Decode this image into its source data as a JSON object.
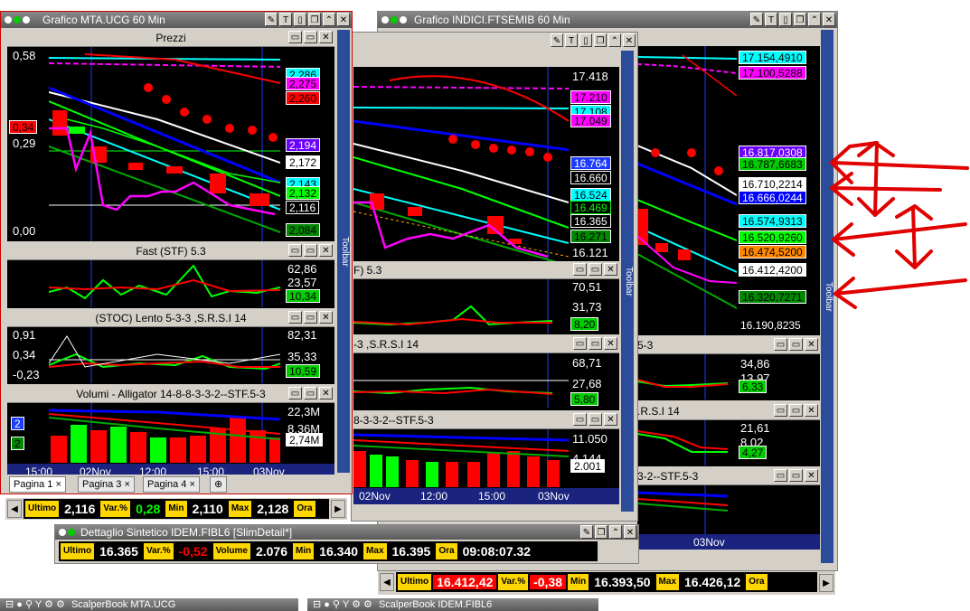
{
  "window_left": {
    "title": "Grafico MTA.UCG 60 Min",
    "price_panel": {
      "title": "Prezzi",
      "y_labels": [
        "0,58",
        "0,29",
        "0,00"
      ],
      "left_tag": "0,34",
      "tags": [
        "2,286",
        "2,275",
        "2,260",
        "2,194",
        "2,172",
        "2,143",
        "2,132",
        "2,116",
        "2,084"
      ]
    },
    "fast_panel": {
      "title": "Fast  (STF)   5.3",
      "tags": [
        "62,86",
        "23,57",
        "10,34"
      ]
    },
    "stoc_panel": {
      "title": "(STOC) Lento   5-3-3 ,S.R.S.I 14",
      "y_labels": [
        "0,91",
        "0,34",
        "-0,23"
      ],
      "tags": [
        "82,31",
        "35,33",
        "10,59"
      ]
    },
    "vol_panel": {
      "title": "Volumi - Alligator 14-8-8-3-3-2--STF.5-3",
      "tags": [
        "22,3M",
        "8,36M",
        "2,74M"
      ],
      "left_tags": [
        "2",
        "2"
      ]
    },
    "time_axis": [
      "15:00",
      "02Nov",
      "12:00",
      "15:00",
      "03Nov"
    ],
    "tabs": [
      "Pagina 1",
      "Pagina 3",
      "Pagina 4"
    ],
    "toolbar_label": "Toolbar"
  },
  "window_middle": {
    "price_tags": [
      "17.418",
      "17.210",
      "17.108",
      "17.049",
      "16.764",
      "16.660",
      "16.524",
      "16.469",
      "16.365",
      "16.271",
      "16.121"
    ],
    "fast_panel": {
      "title": "F)   5.3",
      "tags": [
        "70,51",
        "31,73",
        "8,20"
      ]
    },
    "stoc_panel": {
      "title": "-3 ,S.R.S.I 14",
      "tags": [
        "68,71",
        "27,68",
        "5,80"
      ]
    },
    "vol_panel": {
      "title": "8-3-3-2--STF.5-3",
      "tags": [
        "11.050",
        "4.144",
        "2.001"
      ]
    },
    "time_axis": [
      "02Nov",
      "12:00",
      "15:00",
      "03Nov"
    ],
    "toolbar_label": "Toolbar"
  },
  "window_right": {
    "title": "Grafico INDICI.FTSEMIB 60 Min",
    "price_tags": [
      "17.154,4910",
      "17.100,5288",
      "16.817,0308",
      "16.787,6683",
      "16.710,2214",
      "16.666,0244",
      "16.574,9313",
      "16.520,9260",
      "16.474,5200",
      "16.412,4200",
      "16.320,7271",
      "16.190,8235"
    ],
    "fast_panel": {
      "title": "",
      "tags": []
    },
    "stoc_panel": {
      "title": "5-3",
      "tags": [
        "34,86",
        "13,97",
        "6,33"
      ]
    },
    "rsi_panel": {
      "title": ".R.S.I 14",
      "tags": [
        "21,61",
        "8,02",
        "4,27"
      ]
    },
    "vol_panel": {
      "title": "3-2--STF.5-3"
    },
    "time_axis": [
      "03Nov"
    ],
    "toolbar_label": "Toolbar"
  },
  "quote_left": {
    "ultimo_label": "Ultimo",
    "ultimo": "2,116",
    "var_label": "Var.%",
    "var": "0,28",
    "min_label": "Min",
    "min": "2,110",
    "max_label": "Max",
    "max": "2,128",
    "ora_label": "Ora"
  },
  "detail_window": {
    "title": "Dettaglio Sintetico IDEM.FIBL6 [SlimDetail*]",
    "ultimo_label": "Ultimo",
    "ultimo": "16.365",
    "var_label": "Var.%",
    "var": "-0,52",
    "volume_label": "Volume",
    "volume": "2.076",
    "min_label": "Min",
    "min": "16.340",
    "max_label": "Max",
    "max": "16.395",
    "ora_label": "Ora",
    "ora": "09:08:07.32"
  },
  "quote_right": {
    "ultimo_label": "Ultimo",
    "ultimo": "16.412,42",
    "var_label": "Var.%",
    "var": "-0,38",
    "min_label": "Min",
    "min": "16.393,50",
    "max_label": "Max",
    "max": "16.426,12",
    "ora_label": "Ora"
  },
  "bottom_windows": [
    "ScalperBook MTA.UCG",
    "ScalperBook IDEM.FIBL6"
  ],
  "colors": {
    "up": "#00ff00",
    "down": "#ff0000",
    "axis_bg": "#1a237e",
    "label_bg": "#ffd700",
    "annotation": "#e00000"
  }
}
